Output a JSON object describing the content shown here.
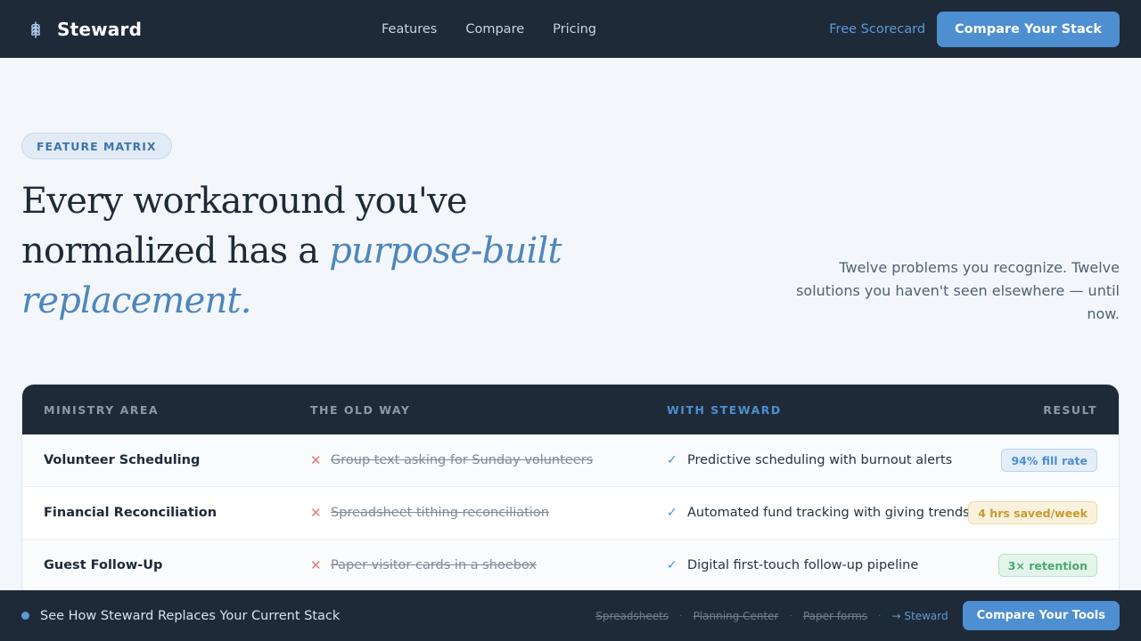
{
  "header": {
    "brand": "Steward",
    "nav": [
      "Features",
      "Compare",
      "Pricing"
    ],
    "free_link": "Free Scorecard",
    "cta": "Compare Your Stack"
  },
  "hero": {
    "badge": "FEATURE MATRIX",
    "headline_plain": "Every workaround you've normalized has a ",
    "headline_accent": "purpose-built replacement.",
    "subtext": "Twelve problems you recognize. Twelve solutions you haven't seen elsewhere — until now."
  },
  "matrix": {
    "columns": [
      "MINISTRY AREA",
      "THE OLD WAY",
      "WITH STEWARD",
      "RESULT"
    ],
    "rows": [
      {
        "area": "Volunteer Scheduling",
        "old": "Group text asking for Sunday volunteers",
        "new": "Predictive scheduling with burnout alerts",
        "result": "94% fill rate",
        "result_color": "#4d8fd0"
      },
      {
        "area": "Financial Reconciliation",
        "old": "Spreadsheet tithing reconciliation",
        "new": "Automated fund tracking with giving trends",
        "result": "4 hrs saved/week",
        "result_color": "#c99a2e"
      },
      {
        "area": "Guest Follow-Up",
        "old": "Paper visitor cards in a shoebox",
        "new": "Digital first-touch follow-up pipeline",
        "result": "3× retention",
        "result_color": "#4aa872"
      }
    ]
  },
  "bottom_bar": {
    "title": "See How Steward Replaces Your Current Stack",
    "old_tools": [
      "Spreadsheets",
      "Planning Center",
      "Paper forms"
    ],
    "new_tool": "→ Steward",
    "cta": "Compare Your Tools"
  },
  "icons": {
    "brand": "wheat-icon",
    "old": "x-icon",
    "new": "check-icon"
  },
  "colors": {
    "accent": "#4d8fd0",
    "dark": "#1f2a38",
    "background": "#f3f7fb"
  }
}
